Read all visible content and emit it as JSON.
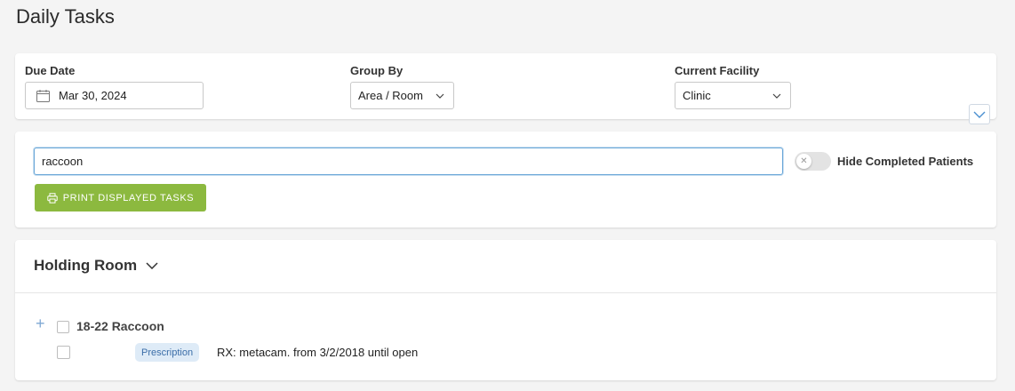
{
  "page": {
    "title": "Daily Tasks"
  },
  "filters": {
    "due_date": {
      "label": "Due Date",
      "value": "Mar 30, 2024"
    },
    "group_by": {
      "label": "Group By",
      "value": "Area / Room"
    },
    "current_facility": {
      "label": "Current Facility",
      "value": "Clinic"
    }
  },
  "search": {
    "value": "raccoon",
    "toggle_label": "Hide Completed Patients",
    "toggle_on": false,
    "print_label": "PRINT DISPLAYED TASKS"
  },
  "room": {
    "name": "Holding Room",
    "patients": [
      {
        "name": "18-22 Raccoon",
        "tasks": [
          {
            "badge": "Prescription",
            "text": "RX: metacam. from 3/2/2018 until open"
          }
        ]
      }
    ]
  },
  "colors": {
    "accent_green": "#8cb93f",
    "focus_blue": "#6aa7d8",
    "badge_bg": "#deebf7"
  }
}
